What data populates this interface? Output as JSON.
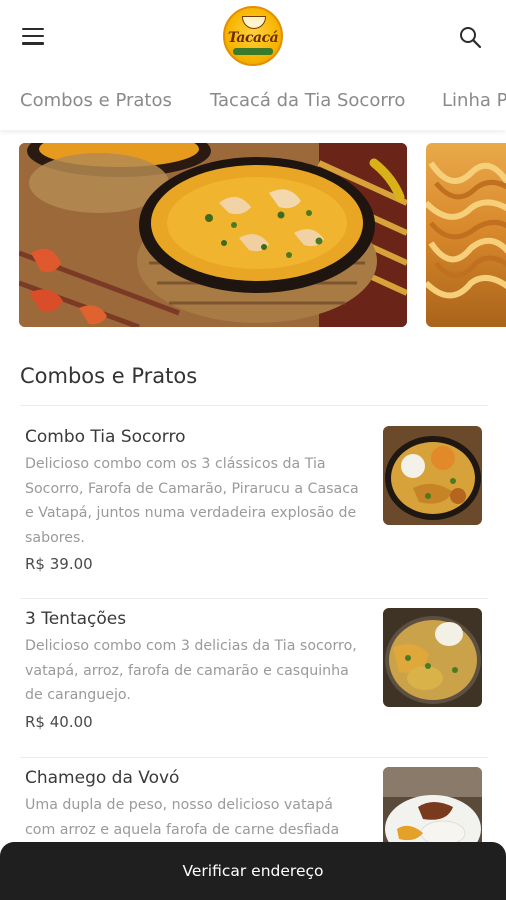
{
  "header": {
    "logo_text": "Tacacá",
    "menu_icon": "hamburger-menu-icon",
    "search_icon": "search-icon"
  },
  "categories": [
    {
      "label": "Combos e Pratos"
    },
    {
      "label": "Tacacá da Tia Socorro"
    },
    {
      "label": "Linha P"
    }
  ],
  "section": {
    "title": "Combos e Pratos"
  },
  "products": [
    {
      "name": "Combo Tia Socorro",
      "description": "Delicioso combo com os 3 clássicos da Tia Socorro, Farofa de Camarão, Pirarucu a Casaca e Vatapá, juntos numa verdadeira explosão de sabores.",
      "price": "R$ 39.00"
    },
    {
      "name": "3 Tentações",
      "description": "Delicioso combo com 3 delicias da Tia socorro, vatapá, arroz, farofa de camarão e casquinha de caranguejo.",
      "price": "R$ 40.00"
    },
    {
      "name": "Chamego da Vovó",
      "description": "Uma dupla de peso, nosso delicioso vatapá com arroz e aquela farofa de carne desfiada"
    }
  ],
  "footer": {
    "button_label": "Verificar endereço"
  },
  "colors": {
    "logo_yellow": "#f7b500",
    "bottom_bar": "#1f1f1f",
    "muted_text": "#9a9a9a"
  }
}
